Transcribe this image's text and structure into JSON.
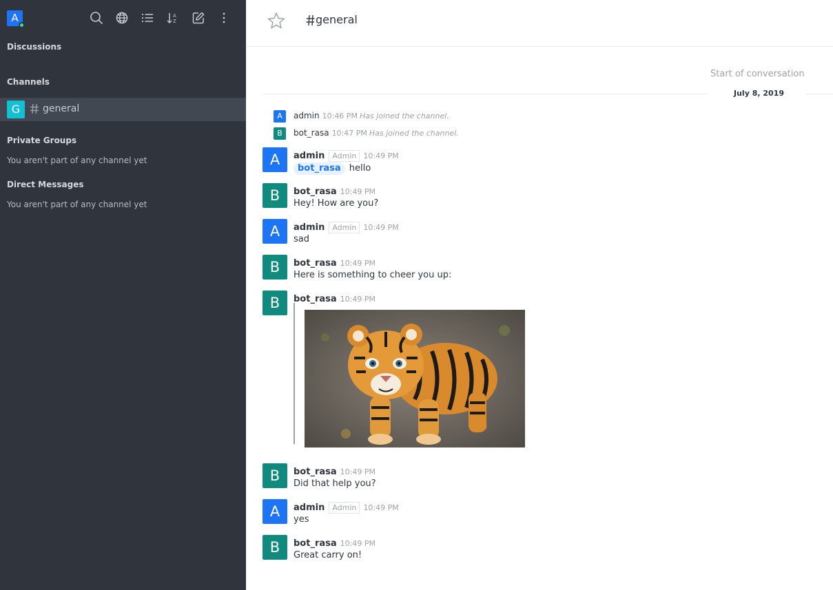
{
  "user": {
    "avatar_letter": "A",
    "status": "online"
  },
  "toolbar": {
    "icons": [
      "search-icon",
      "directory-icon",
      "view-mode-icon",
      "sort-icon",
      "create-new-icon",
      "kebab-menu-icon"
    ]
  },
  "sidebar": {
    "discussions_title": "Discussions",
    "channels_title": "Channels",
    "channels": [
      {
        "avatar_letter": "G",
        "name": "general"
      }
    ],
    "private_groups_title": "Private Groups",
    "private_groups_empty": "You aren't part of any channel yet",
    "direct_messages_title": "Direct Messages",
    "direct_messages_empty": "You aren't part of any channel yet"
  },
  "room": {
    "name": "general"
  },
  "conversation": {
    "start_label": "Start of conversation",
    "date": "July 8, 2019"
  },
  "system_messages": [
    {
      "avatar_letter": "A",
      "user": "admin",
      "time": "10:46 PM",
      "text": "Has joined the channel."
    },
    {
      "avatar_letter": "B",
      "user": "bot_rasa",
      "time": "10:47 PM",
      "text": "Has joined the channel."
    }
  ],
  "messages": [
    {
      "avatar_letter": "A",
      "user": "admin",
      "role": "Admin",
      "time": "10:49 PM",
      "mention": "bot_rasa",
      "text": "hello"
    },
    {
      "avatar_letter": "B",
      "user": "bot_rasa",
      "time": "10:49 PM",
      "text": "Hey! How are you?"
    },
    {
      "avatar_letter": "A",
      "user": "admin",
      "role": "Admin",
      "time": "10:49 PM",
      "text": "sad"
    },
    {
      "avatar_letter": "B",
      "user": "bot_rasa",
      "time": "10:49 PM",
      "text": "Here is something to cheer you up:"
    },
    {
      "avatar_letter": "B",
      "user": "bot_rasa",
      "time": "10:49 PM",
      "attachment": "tiger-cub-image"
    },
    {
      "avatar_letter": "B",
      "user": "bot_rasa",
      "time": "10:49 PM",
      "text": "Did that help you?"
    },
    {
      "avatar_letter": "A",
      "user": "admin",
      "role": "Admin",
      "time": "10:49 PM",
      "text": "yes"
    },
    {
      "avatar_letter": "B",
      "user": "bot_rasa",
      "time": "10:49 PM",
      "text": "Great carry on!"
    }
  ],
  "colors": {
    "sidebar_bg": "#2f343d",
    "admin_avatar": "#1d74f5",
    "bot_avatar": "#10897f",
    "channel_avatar": "#12c0d6",
    "online": "#2de0a5"
  }
}
